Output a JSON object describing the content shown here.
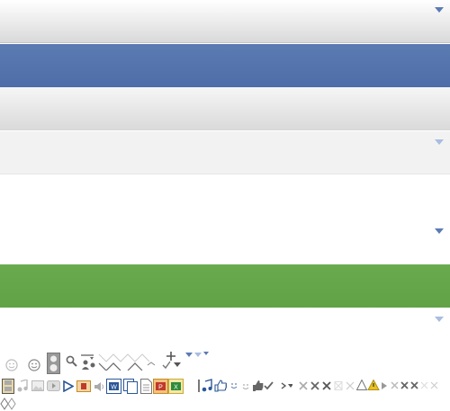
{
  "bands": [
    {
      "name": "gray-header",
      "color": "#d9d9d9"
    },
    {
      "name": "blue-header",
      "color": "#4f6da8"
    },
    {
      "name": "gray-toolbar",
      "color": "#dadada"
    },
    {
      "name": "light-panel",
      "color": "#f2f2f2"
    },
    {
      "name": "white-panel",
      "color": "#ffffff"
    },
    {
      "name": "green-header",
      "color": "#62a247"
    },
    {
      "name": "white-footer",
      "color": "#ffffff"
    }
  ],
  "icons": [
    "smiley-icon",
    "smiley-icon",
    "speaker-icon",
    "search-icon",
    "user-icon",
    "arrow-icon",
    "plus-icon",
    "dropdown-icon",
    "check-icon",
    "film-icon",
    "music-icon",
    "image-icon",
    "video-icon",
    "play-icon",
    "media-icon",
    "volume-icon",
    "word-doc-icon",
    "copy-icon",
    "document-icon",
    "pdf-icon",
    "excel-icon",
    "playlist-icon",
    "thumbs-up-icon",
    "checkmark-icon",
    "chevron-right-icon",
    "close-icon",
    "warning-icon",
    "triangle-right-icon",
    "diamond-icon"
  ],
  "colors": {
    "accent_blue": "#5b7bb3",
    "green": "#62a247",
    "warning": "#e8c220",
    "word": "#2b5797",
    "pdf": "#c0392b",
    "excel": "#2e8b3a"
  }
}
